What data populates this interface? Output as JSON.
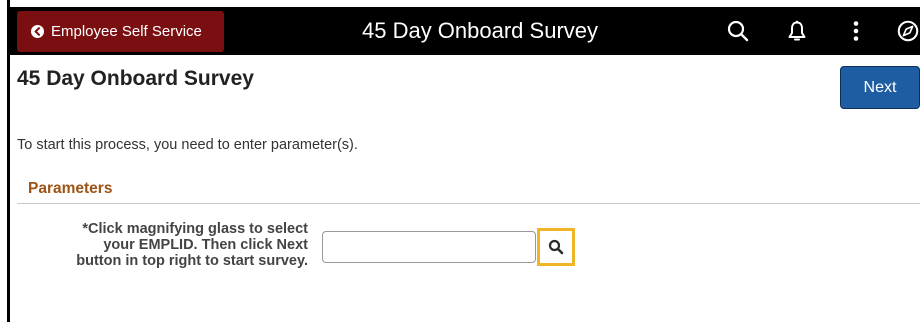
{
  "header": {
    "back_label": "Employee Self Service",
    "title": "45 Day Onboard Survey",
    "icons": [
      "search-icon",
      "bell-icon",
      "more-vertical-icon",
      "compass-icon"
    ]
  },
  "page": {
    "title": "45 Day Onboard Survey",
    "next_label": "Next",
    "instruction": "To start this process, you need to enter parameter(s)."
  },
  "parameters": {
    "heading": "Parameters",
    "field_label_line1": "*Click magnifying glass to select",
    "field_label_line2": "your EMPLID. Then click Next",
    "field_label_line3": "button in top right to start survey.",
    "field_value": "",
    "lookup_icon": "search-icon"
  },
  "colors": {
    "banner": "#000000",
    "back_button": "#7a0f12",
    "next_button": "#1f5da3",
    "section_heading": "#9c5516",
    "lookup_highlight": "#f0b429"
  }
}
